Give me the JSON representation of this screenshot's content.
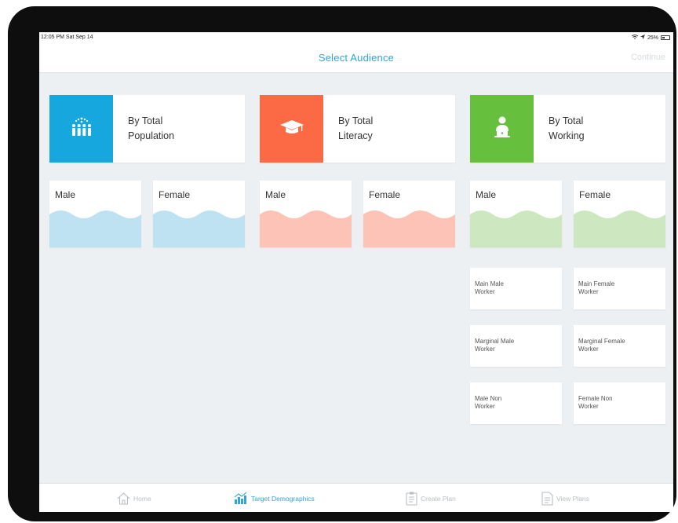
{
  "status": {
    "time": "12:05 PM  Sat Sep 14",
    "battery": "25%",
    "wifi_icon": "wifi-icon",
    "location_icon": "location-arrow-icon"
  },
  "header": {
    "title": "Select Audience",
    "continue_label": "Continue"
  },
  "categories": [
    {
      "line1": "By Total",
      "line2": "Population",
      "color": "#17a7df",
      "icon": "population-icon"
    },
    {
      "line1": "By Total",
      "line2": "Literacy",
      "color": "#fb6a45",
      "icon": "graduation-cap-icon"
    },
    {
      "line1": "By Total",
      "line2": "Working",
      "color": "#66c03e",
      "icon": "worker-icon"
    }
  ],
  "genders": {
    "population": {
      "male": "Male",
      "female": "Female",
      "wave_color": "#bfe2f2"
    },
    "literacy": {
      "male": "Male",
      "female": "Female",
      "wave_color": "#fcc3b6"
    },
    "working": {
      "male": "Male",
      "female": "Female",
      "wave_color": "#cde8c0"
    }
  },
  "workers": [
    {
      "line1": "Main Male",
      "line2": "Worker"
    },
    {
      "line1": "Main Female",
      "line2": "Worker"
    },
    {
      "line1": "Marginal Male",
      "line2": "Worker"
    },
    {
      "line1": "Marginal Female",
      "line2": "Worker"
    },
    {
      "line1": "Male Non",
      "line2": "Worker"
    },
    {
      "line1": "Female Non",
      "line2": "Worker"
    }
  ],
  "tabs": [
    {
      "label": "Home",
      "icon": "home-icon"
    },
    {
      "label": "Target Demographics",
      "icon": "chart-icon"
    },
    {
      "label": "Create Plan",
      "icon": "clipboard-icon"
    },
    {
      "label": "View Plans",
      "icon": "document-icon"
    }
  ],
  "colors": {
    "accent": "#2ea6dd",
    "background": "#ecf0f2"
  }
}
